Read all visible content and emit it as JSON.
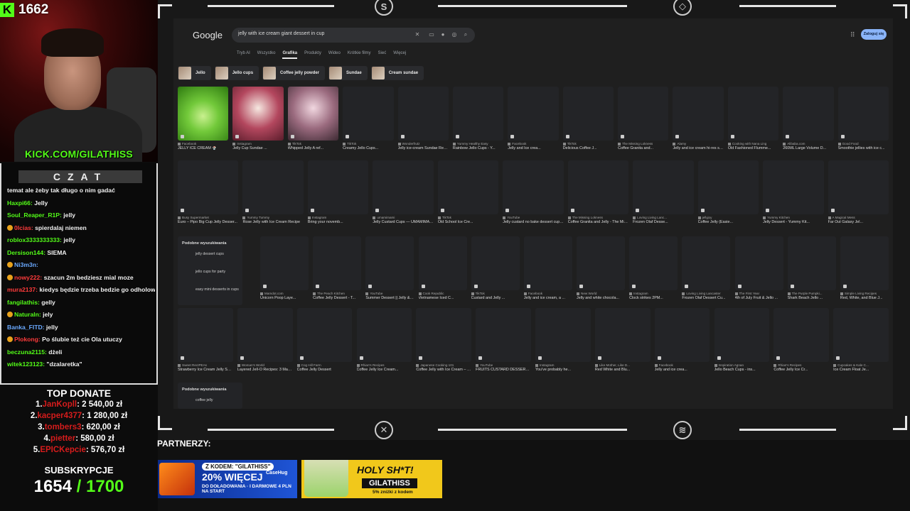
{
  "stream": {
    "follower_count": "1662",
    "kick_url": "KICK.COM/GILATHISS"
  },
  "chat": {
    "header": "CZAT",
    "messages": [
      {
        "user": "",
        "text": "temat ale żeby tak długo o nim gadać",
        "color": "",
        "badge": false
      },
      {
        "user": "Haxpi66:",
        "text": "Jelly",
        "color": "green",
        "badge": false
      },
      {
        "user": "Soul_Reaper_R1P:",
        "text": "jelly",
        "color": "green",
        "badge": false
      },
      {
        "user": "0lcias:",
        "text": "spierdalaj niemen",
        "color": "red",
        "badge": true
      },
      {
        "user": "roblox3333333333:",
        "text": "jelly",
        "color": "green",
        "badge": false
      },
      {
        "user": "Dersison144:",
        "text": "SIEMA",
        "color": "green",
        "badge": false
      },
      {
        "user": "Ni3m3n:",
        "text": "",
        "color": "blue",
        "badge": true
      },
      {
        "user": "nowy222:",
        "text": "szacun 2m bedziesz mial moze",
        "color": "red",
        "badge": true
      },
      {
        "user": "mura2137:",
        "text": "kiedys będzie trzeba bedzie go odholowywac",
        "color": "red",
        "badge": false,
        "multi": true
      },
      {
        "user": "fangilathis:",
        "text": "gelly",
        "color": "green",
        "badge": false
      },
      {
        "user": "Naturaln:",
        "text": "jely",
        "color": "green",
        "badge": true
      },
      {
        "user": "Banka_FITD:",
        "text": "jelly",
        "color": "blue",
        "badge": false
      },
      {
        "user": "Plokong:",
        "text": "Po ślubie też cie Ola utuczy",
        "color": "red",
        "badge": true
      },
      {
        "user": "beczuna2115:",
        "text": "dżeli",
        "color": "green",
        "badge": false
      },
      {
        "user": "witek123123:",
        "text": "\"dzalaretka\"",
        "color": "green",
        "badge": false
      }
    ]
  },
  "top_donate": {
    "title": "TOP DONATE",
    "entries": [
      {
        "rank": "1.",
        "name": "JanKopll",
        "amount": "2 540,00 zł"
      },
      {
        "rank": "2.",
        "name": "kacper4377",
        "amount": "1 280,00 zł"
      },
      {
        "rank": "3.",
        "name": "tombers3",
        "amount": "620,00 zł"
      },
      {
        "rank": "4.",
        "name": "pietter",
        "amount": "580,00 zł"
      },
      {
        "rank": "5.",
        "name": "EPICKepcie",
        "amount": "576,70 zł"
      }
    ]
  },
  "subs": {
    "title": "SUBSKRYPCJE",
    "current": "1654",
    "goal": "/ 1700"
  },
  "partners": {
    "label": "PARTNERZY:",
    "case": {
      "code": "Z KODEM: \"GILATHISS\"",
      "big": "20% WIĘCEJ",
      "big2": "DO DOŁADOWANIA",
      "small": "I DARMOWE 4 PLN NA START",
      "brand": "CaseHug"
    },
    "holy": {
      "t1": "HOLY SH*T!",
      "t2": "GILATHISS",
      "t3": "5% zniżki z kodem"
    }
  },
  "google": {
    "logo": "Google",
    "query": "jelly with ice cream giant dessert in cup",
    "login": "Zaloguj się",
    "tabs": [
      "Tryb AI",
      "Wszystko",
      "Grafika",
      "Produkty",
      "Wideo",
      "Krótkie filmy",
      "Sieć",
      "Więcej"
    ],
    "active_tab": 2,
    "chips": [
      "Jello",
      "Jello cups",
      "Coffee jelly powder",
      "Sundae",
      "Cream sundae"
    ],
    "row1": [
      {
        "src": "Facebook",
        "title": "JELLY ICE CREAM 🍨",
        "img": "jelly1"
      },
      {
        "src": "Instagram",
        "title": "Jelly Cup Sundae ...",
        "img": "jelly2"
      },
      {
        "src": "TikTok",
        "title": "Whipped Jelly A ref...",
        "img": "jelly3"
      },
      {
        "src": "TikTok",
        "title": "Creamy Jello Cups...",
        "img": ""
      },
      {
        "src": "Wonderfrutz",
        "title": "Jelly ice-cream Sundae Recipe – Wo...",
        "img": ""
      },
      {
        "src": "Yummy Healthy Easy",
        "title": "Rainbow Jello Cups - Y...",
        "img": ""
      },
      {
        "src": "Facebook",
        "title": "Jelly and Ice crea...",
        "img": ""
      },
      {
        "src": "TikTok",
        "title": "Delicious Coffee J...",
        "img": ""
      },
      {
        "src": "The Missing Lokness",
        "title": "Coffee Granita and...",
        "img": ""
      },
      {
        "src": "Alamy",
        "title": "Jelly and ice cream hi-res stock...",
        "img": ""
      },
      {
        "src": "Cooking with Nana Ling",
        "title": "Old Fashioned Flumme...",
        "img": ""
      },
      {
        "src": "Alibaba.com",
        "title": "260ML Large Volume D...",
        "img": ""
      },
      {
        "src": "Good Food",
        "title": "Smoothie jellies with ice c...",
        "img": ""
      }
    ],
    "row2": [
      {
        "src": "Busy Supermarket",
        "title": "Euro – Pipo Big Cup Jelly Desser..."
      },
      {
        "src": "Yummy Tummy",
        "title": "Rose Jelly with Ice Cream Recipe"
      },
      {
        "src": "Instagram",
        "title": "Bring your novemb..."
      },
      {
        "src": "umamimami",
        "title": "Jelly Custard Cups — UMAMIMAMI"
      },
      {
        "src": "TikTok",
        "title": "Old School Ice Cre..."
      },
      {
        "src": "YouTube",
        "title": "Jelly custard no bake dessert cups. Easy ..."
      },
      {
        "src": "The Missing Lokness",
        "title": "Coffee Granita and Jelly - The Missing Lo..."
      },
      {
        "src": "Loving Living Lanc...",
        "title": "Frozen Olaf Desse..."
      },
      {
        "src": "jellyjoy",
        "title": "Coffee Jelly (Easie..."
      },
      {
        "src": "Yummy Kitchen",
        "title": "Jelly Dessert - Yummy Kit..."
      },
      {
        "src": "A Magical Mess",
        "title": "Far Out Galaxy Jel..."
      }
    ],
    "related1": {
      "title": "Podobne wyszukiwania",
      "items": [
        "jelly dessert cups",
        "jello cups for party",
        "easy mini desserts in cups"
      ]
    },
    "row3": [
      {
        "src": "Mamdot.com",
        "title": "Unicorn Poop Laye..."
      },
      {
        "src": "The Peach Kitchen",
        "title": "Coffee Jelly Dessert - T..."
      },
      {
        "src": "YouTube",
        "title": "Summer Dessert || Jelly & Ice-..."
      },
      {
        "src": "Cook Republic",
        "title": "Vietnamese Iced C..."
      },
      {
        "src": "TikTok",
        "title": "Custard and Jelly ..."
      },
      {
        "src": "Facebook",
        "title": "Jelly and ice cream, a ..."
      },
      {
        "src": "New World",
        "title": "Jelly and white chocola..."
      },
      {
        "src": "Instagram",
        "title": "Clock strikes 2PM..."
      },
      {
        "src": "Loving Living Lancaster",
        "title": "Frozen Olaf Dessert Cu..."
      },
      {
        "src": "The First Year",
        "title": "4th of July Fruit & Jello ..."
      },
      {
        "src": "The Purple Pumpki...",
        "title": "Shark Beach Jello ..."
      },
      {
        "src": "Simple Living Recipes",
        "title": "Red, White, and Blue J..."
      }
    ],
    "row4": [
      {
        "src": "Sweet RecIPEAs",
        "title": "Strawberry Ice Cream Jelly Shots -..."
      },
      {
        "src": "Woman's World",
        "title": "Layered Jell-O Recipes: 3 Make-Ahead..."
      },
      {
        "src": "Cog Hill Farm",
        "title": "Coffee Jelly Dessert"
      },
      {
        "src": "Rhian's Recipes",
        "title": "Coffee Jelly Ice Cream..."
      },
      {
        "src": "Japanese Cooking 101",
        "title": "Coffee Jelly with Ice Cream – Japa..."
      },
      {
        "src": "YouTube",
        "title": "FRUITS CUSTARD DESSERT CUP | C..."
      },
      {
        "src": "Instagram",
        "title": "You've probably he..."
      },
      {
        "src": "Like Mother, Like D...",
        "title": "Red White and Blu..."
      },
      {
        "src": "Facebook",
        "title": "Jelly and ice crea..."
      },
      {
        "src": "Inspiration Agnan",
        "title": "Jello Beach Cups - ins..."
      },
      {
        "src": "Rhian's Recipes",
        "title": "Coffee Jelly Ice Cr..."
      },
      {
        "src": "Cupcakes & Kale C...",
        "title": "Ice Cream Float Je..."
      }
    ],
    "related2": {
      "title": "Podobne wyszukiwania",
      "items": [
        "coffee jelly"
      ]
    }
  }
}
